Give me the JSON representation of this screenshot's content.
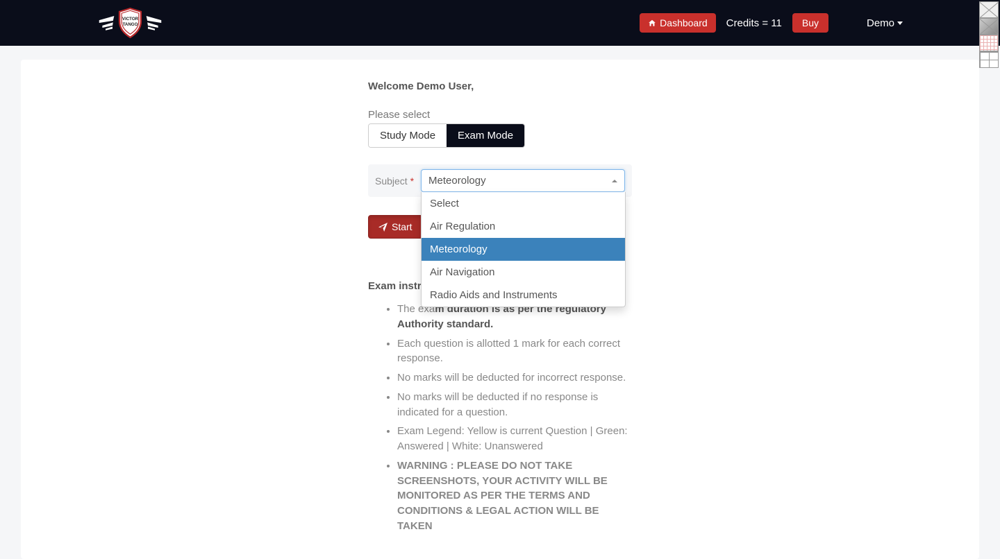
{
  "nav": {
    "dashboard_label": "Dashboard",
    "credits_label": "Credits = 11",
    "buy_label": "Buy",
    "user_label": "Demo"
  },
  "main": {
    "welcome": "Welcome Demo User,",
    "please_select": "Please select",
    "mode_tabs": [
      {
        "label": "Study Mode",
        "active": false
      },
      {
        "label": "Exam Mode",
        "active": true
      }
    ],
    "subject_label": "Subject",
    "subject_selected": "Meteorology",
    "subject_options": [
      "Select",
      "Air Regulation",
      "Meteorology",
      "Air Navigation",
      "Radio Aids and Instruments"
    ],
    "start_label": "Start",
    "instructions_title": "Exam instructions",
    "instructions": [
      {
        "html": "The exam duration is as per the regulatory Authority standard.",
        "strong_prefix": "The exa",
        "bold_suffix": "uthority standard."
      },
      {
        "text": "Each question is allotted 1 mark for each correct response."
      },
      {
        "text": "No marks will be deducted for incorrect response."
      },
      {
        "text": "No marks will be deducted if no response is indicated for a question."
      },
      {
        "text": "Exam Legend: Yellow is current Question | Green: Answered | White: Unanswered"
      },
      {
        "text": "WARNING : PLEASE DO NOT TAKE SCREENSHOTS, YOUR ACTIVITY WILL BE MONITORED AS PER THE TERMS AND CONDITIONS & LEGAL ACTION WILL BE TAKEN",
        "warn": true
      }
    ]
  }
}
